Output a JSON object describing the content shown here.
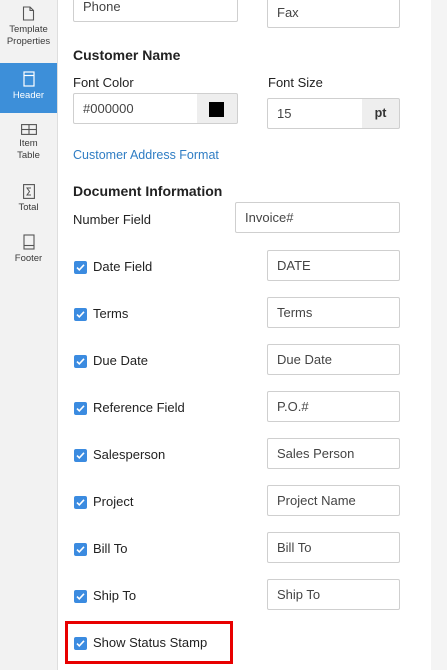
{
  "sidebar": {
    "items": [
      {
        "label": "Template Properties",
        "line1": "Template",
        "line2": "Properties",
        "icon": "document-icon",
        "active": false
      },
      {
        "label": "Header",
        "line1": "Header",
        "line2": "",
        "icon": "header-page-icon",
        "active": true
      },
      {
        "label": "Item Table",
        "line1": "Item",
        "line2": "Table",
        "icon": "table-icon",
        "active": false
      },
      {
        "label": "Total",
        "line1": "Total",
        "line2": "",
        "icon": "sigma-icon",
        "active": false
      },
      {
        "label": "Footer",
        "line1": "Footer",
        "line2": "",
        "icon": "footer-page-icon",
        "active": false
      }
    ]
  },
  "top_fields": {
    "phone": {
      "value": "Phone"
    },
    "fax": {
      "value": "Fax"
    }
  },
  "customer_name": {
    "title": "Customer Name",
    "font_color_label": "Font Color",
    "font_color_value": "#000000",
    "swatch_color": "#000000",
    "font_size_label": "Font Size",
    "font_size_value": "15",
    "font_size_unit": "pt",
    "address_link": "Customer Address Format"
  },
  "document_information": {
    "title": "Document Information",
    "number_field_label": "Number Field",
    "number_field_value": "Invoice#",
    "rows": [
      {
        "label": "Date Field",
        "value": "DATE",
        "checked": true
      },
      {
        "label": "Terms",
        "value": "Terms",
        "checked": true
      },
      {
        "label": "Due Date",
        "value": "Due Date",
        "checked": true
      },
      {
        "label": "Reference Field",
        "value": "P.O.#",
        "checked": true
      },
      {
        "label": "Salesperson",
        "value": "Sales Person",
        "checked": true
      },
      {
        "label": "Project",
        "value": "Project Name",
        "checked": true
      },
      {
        "label": "Bill To",
        "value": "Bill To",
        "checked": true
      },
      {
        "label": "Ship To",
        "value": "Ship To",
        "checked": true
      }
    ],
    "status_stamp": {
      "label": "Show Status Stamp",
      "checked": true
    }
  },
  "colors": {
    "accent": "#3d8fd9",
    "checkbox": "#3b8be0",
    "link": "#2f7dc4",
    "highlight": "#e80000"
  }
}
